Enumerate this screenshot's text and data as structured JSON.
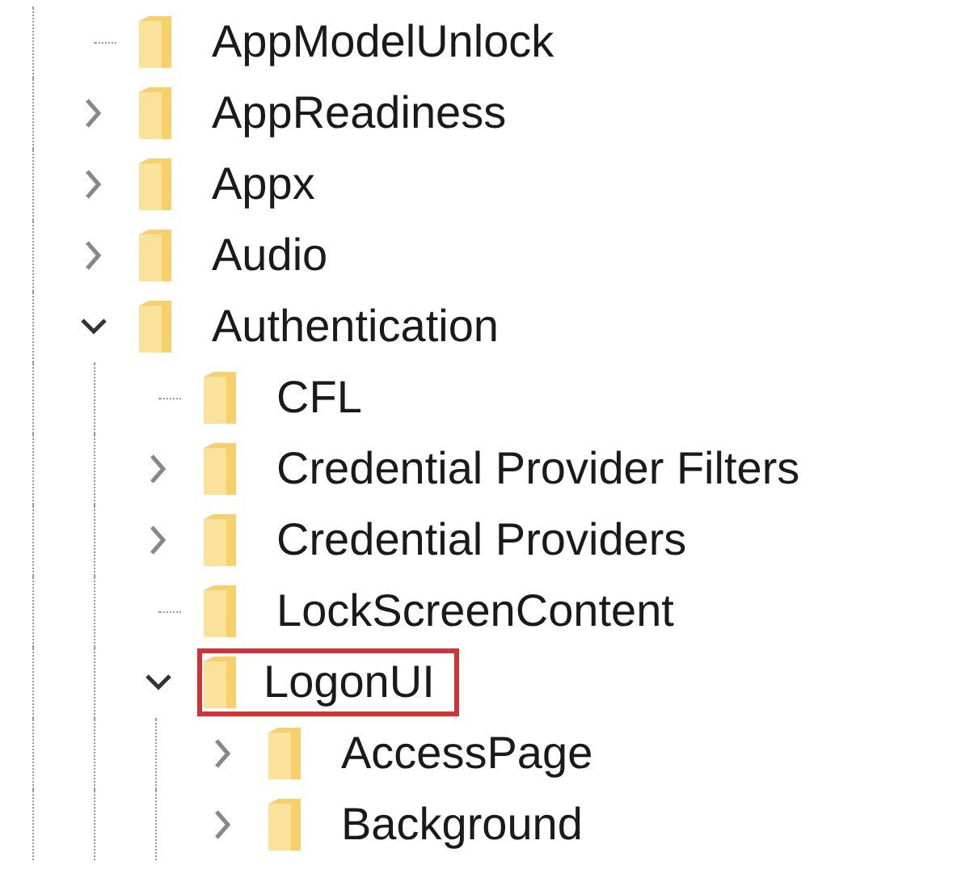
{
  "tree": [
    {
      "label": "AppModelUnlock",
      "kind": "leaf",
      "outlined": false
    },
    {
      "label": "AppReadiness",
      "kind": "branch",
      "expanded": false,
      "outlined": false
    },
    {
      "label": "Appx",
      "kind": "branch",
      "expanded": false,
      "outlined": false
    },
    {
      "label": "Audio",
      "kind": "branch",
      "expanded": false,
      "outlined": false
    },
    {
      "label": "Authentication",
      "kind": "branch",
      "expanded": true,
      "outlined": false,
      "children": [
        {
          "label": "CFL",
          "kind": "leaf",
          "outlined": false
        },
        {
          "label": "Credential Provider Filters",
          "kind": "branch",
          "expanded": false,
          "outlined": false
        },
        {
          "label": "Credential Providers",
          "kind": "branch",
          "expanded": false,
          "outlined": false
        },
        {
          "label": "LockScreenContent",
          "kind": "leaf",
          "outlined": false
        },
        {
          "label": "LogonUI",
          "kind": "branch",
          "expanded": true,
          "outlined": true,
          "children": [
            {
              "label": "AccessPage",
              "kind": "branch",
              "expanded": false,
              "outlined": false
            },
            {
              "label": "Background",
              "kind": "branch",
              "expanded": false,
              "outlined": false
            }
          ]
        }
      ]
    }
  ]
}
